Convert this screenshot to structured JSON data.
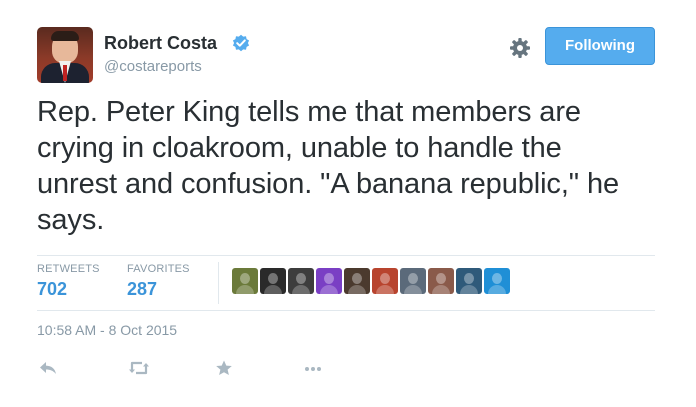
{
  "author": {
    "name": "Robert Costa",
    "handle": "@costareports"
  },
  "follow_button": {
    "label": "Following"
  },
  "tweet": {
    "text": "Rep. Peter King tells me that members are crying in cloakroom, unable to handle the unrest and confusion. \"A banana republic,\" he says.",
    "timestamp": "10:58 AM - 8 Oct 2015"
  },
  "stats": {
    "retweets_label": "RETWEETS",
    "retweets_count": "702",
    "favorites_label": "FAVORITES",
    "favorites_count": "287"
  },
  "favoriters": [
    {
      "icon": "user-avatar",
      "color": "#6b7a3a"
    },
    {
      "icon": "user-avatar",
      "color": "#2a2a2a"
    },
    {
      "icon": "user-avatar",
      "color": "#3d3d3d"
    },
    {
      "icon": "user-avatar",
      "color": "#7a3fc4"
    },
    {
      "icon": "user-avatar",
      "color": "#4b3a2e"
    },
    {
      "icon": "user-avatar",
      "color": "#b8442e"
    },
    {
      "icon": "user-avatar",
      "color": "#5b6a7a"
    },
    {
      "icon": "user-avatar",
      "color": "#8a5a4a"
    },
    {
      "icon": "user-avatar",
      "color": "#2f5a7a"
    },
    {
      "icon": "user-avatar",
      "color": "#1f8fd6"
    }
  ],
  "actions": [
    "reply-icon",
    "retweet-icon",
    "favorite-icon",
    "more-icon"
  ],
  "colors": {
    "accent": "#55acee",
    "link": "#3b94d9",
    "muted": "#8899a6",
    "text": "#292f33"
  }
}
